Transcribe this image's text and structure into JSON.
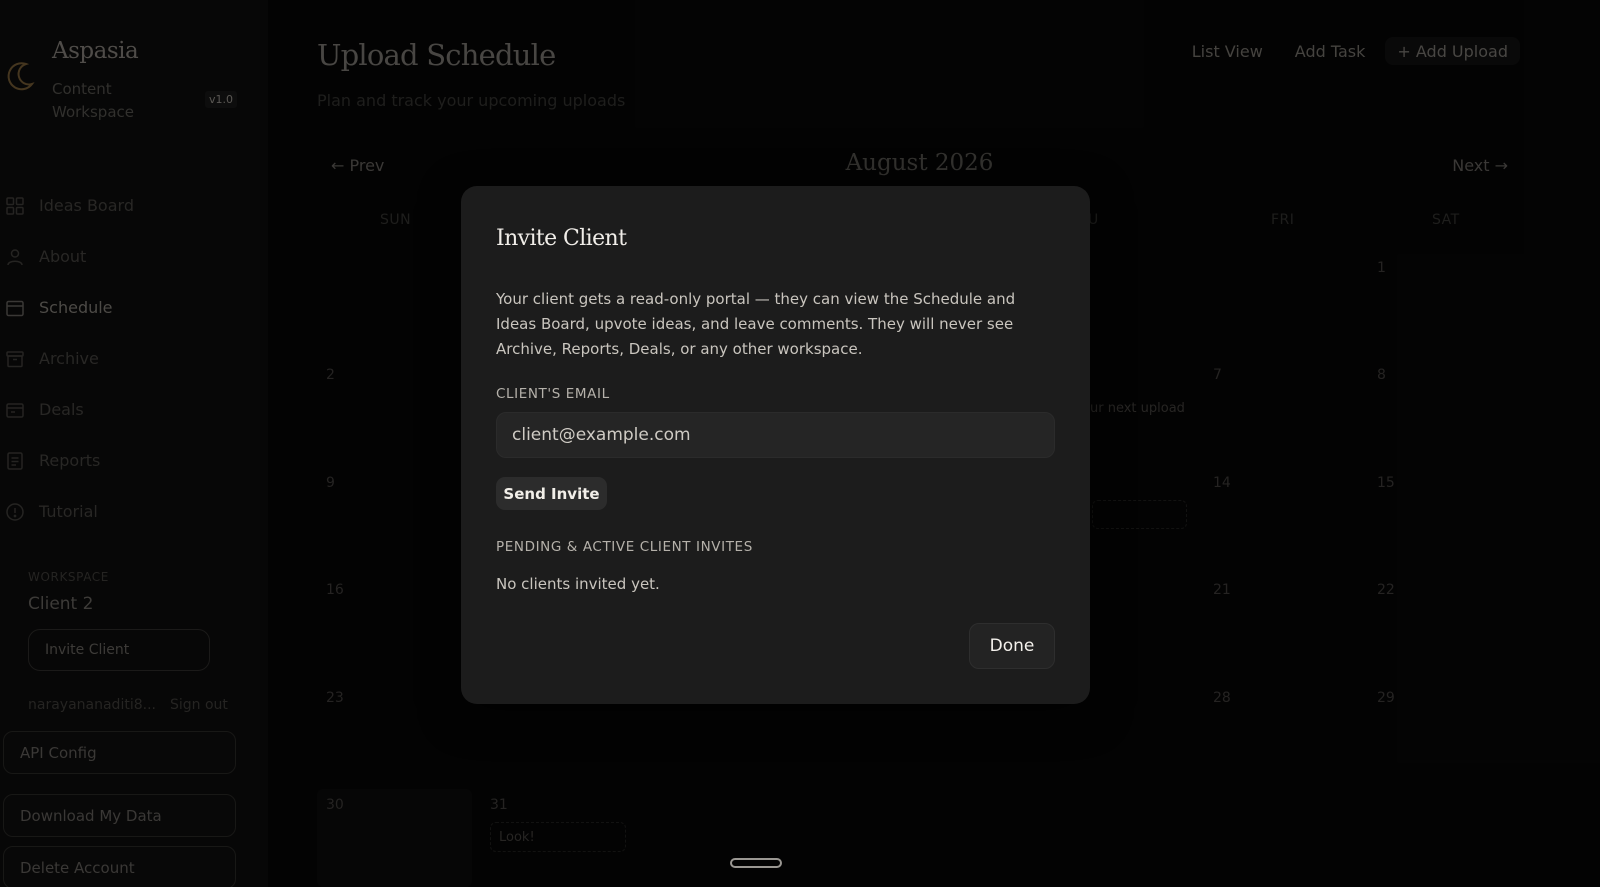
{
  "sidebar": {
    "brand_title": "Aspasia",
    "brand_subtitle": "Content Workspace",
    "version": "v1.0",
    "nav": [
      {
        "label": "Ideas Board",
        "icon": "grid-icon"
      },
      {
        "label": "About",
        "icon": "user-icon"
      },
      {
        "label": "Schedule",
        "icon": "calendar-icon",
        "active": true
      },
      {
        "label": "Archive",
        "icon": "archive-box-icon"
      },
      {
        "label": "Deals",
        "icon": "wallet-icon"
      },
      {
        "label": "Reports",
        "icon": "document-icon"
      },
      {
        "label": "Tutorial",
        "icon": "info-circle-icon"
      }
    ],
    "workspace_caption": "WORKSPACE",
    "workspace_name": "Client 2",
    "invite_label": "Invite Client",
    "user_email": "narayananaditi8...",
    "sign_out": "Sign out",
    "api_config": "API Config",
    "download_data": "Download My Data",
    "delete_account": "Delete Account"
  },
  "header": {
    "title": "Upload Schedule",
    "subtitle": "Plan and track your upcoming uploads",
    "actions": {
      "list_view": "List View",
      "add_task": "Add Task",
      "add_upload": "+ Add Upload"
    }
  },
  "calendar": {
    "prev": "← Prev",
    "next": "Next →",
    "month": "August 2026",
    "weekdays": [
      "SUN",
      "FRI",
      "SAT"
    ],
    "partial_weekday": "U",
    "days": [
      "1",
      "2",
      "7",
      "8",
      "9",
      "14",
      "15",
      "16",
      "21",
      "22",
      "23",
      "28",
      "29",
      "30",
      "31"
    ],
    "events": {
      "partial_next_upload": "ur next upload",
      "look": "Look!"
    }
  },
  "modal": {
    "title": "Invite Client",
    "description": "Your client gets a read-only portal — they can view the Schedule and Ideas Board, upvote ideas, and leave comments. They will never see Archive, Reports, Deals, or any other workspace.",
    "email_label": "CLIENT'S EMAIL",
    "email_placeholder": "client@example.com",
    "send_label": "Send Invite",
    "pending_label": "PENDING & ACTIVE CLIENT INVITES",
    "empty_text": "No clients invited yet.",
    "done_label": "Done"
  },
  "colors": {
    "background": "#060606",
    "modal": "#1c1c1c",
    "accent_logo": "#8a6a3a"
  }
}
